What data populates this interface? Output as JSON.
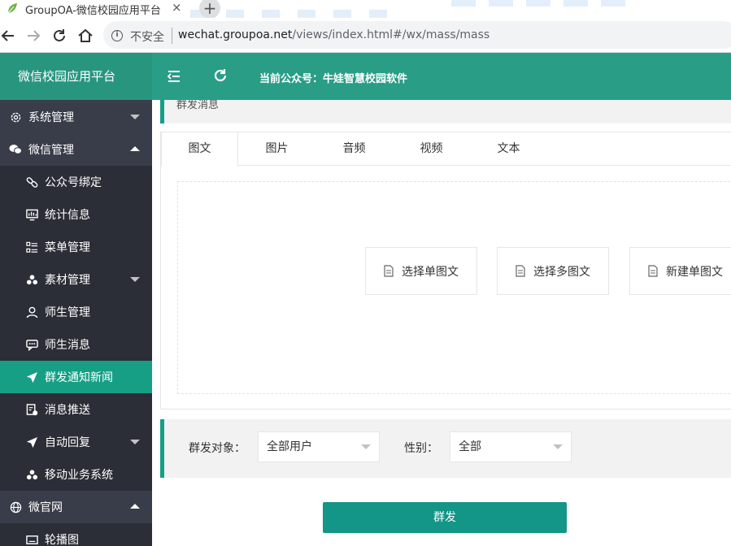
{
  "browser": {
    "tab_title": "GroupOA-微信校园应用平台",
    "close_glyph": "×",
    "new_tab_glyph": "+",
    "security_label": "不安全",
    "url_host": "wechat.groupoa.net",
    "url_path": "/views/index.html#/wx/mass/mass"
  },
  "header": {
    "brand": "微信校园应用平台",
    "current_account": "当前公众号：牛娃智慧校园软件"
  },
  "sidebar": {
    "items": [
      {
        "label": "系统管理",
        "icon": "gear-icon",
        "level": "group",
        "caret": "down"
      },
      {
        "label": "微信管理",
        "icon": "wechat-icon",
        "level": "group",
        "caret": "up"
      },
      {
        "label": "公众号绑定",
        "icon": "link-icon",
        "level": "sub"
      },
      {
        "label": "统计信息",
        "icon": "chart-icon",
        "level": "sub"
      },
      {
        "label": "菜单管理",
        "icon": "menu-list-icon",
        "level": "sub"
      },
      {
        "label": "素材管理",
        "icon": "cubes-icon",
        "level": "sub",
        "caret": "down"
      },
      {
        "label": "师生管理",
        "icon": "user-icon",
        "level": "sub"
      },
      {
        "label": "师生消息",
        "icon": "message-icon",
        "level": "sub"
      },
      {
        "label": "群发通知新闻",
        "icon": "send-icon",
        "level": "sub",
        "active": true
      },
      {
        "label": "消息推送",
        "icon": "push-icon",
        "level": "sub"
      },
      {
        "label": "自动回复",
        "icon": "send-icon",
        "level": "sub",
        "caret": "down"
      },
      {
        "label": "移动业务系统",
        "icon": "cubes-icon",
        "level": "sub"
      },
      {
        "label": "微官网",
        "icon": "globe-icon",
        "level": "group",
        "caret": "up"
      },
      {
        "label": "轮播图",
        "icon": "slideshow-icon",
        "level": "sub"
      }
    ]
  },
  "main": {
    "breadcrumb": "群发消息",
    "tabs": [
      "图文",
      "图片",
      "音频",
      "视频",
      "文本"
    ],
    "active_tab": 0,
    "buttons": {
      "select_single": "选择单图文",
      "select_multi": "选择多图文",
      "new_single": "新建单图文"
    },
    "filter": {
      "target_label": "群发对象：",
      "target_value": "全部用户",
      "gender_label": "性别：",
      "gender_value": "全部"
    },
    "send_label": "群发"
  },
  "colors": {
    "header": "#2a9d87",
    "sidebar": "#393d49",
    "sidebar_sub": "#2b2e37",
    "accent": "#169f85"
  }
}
